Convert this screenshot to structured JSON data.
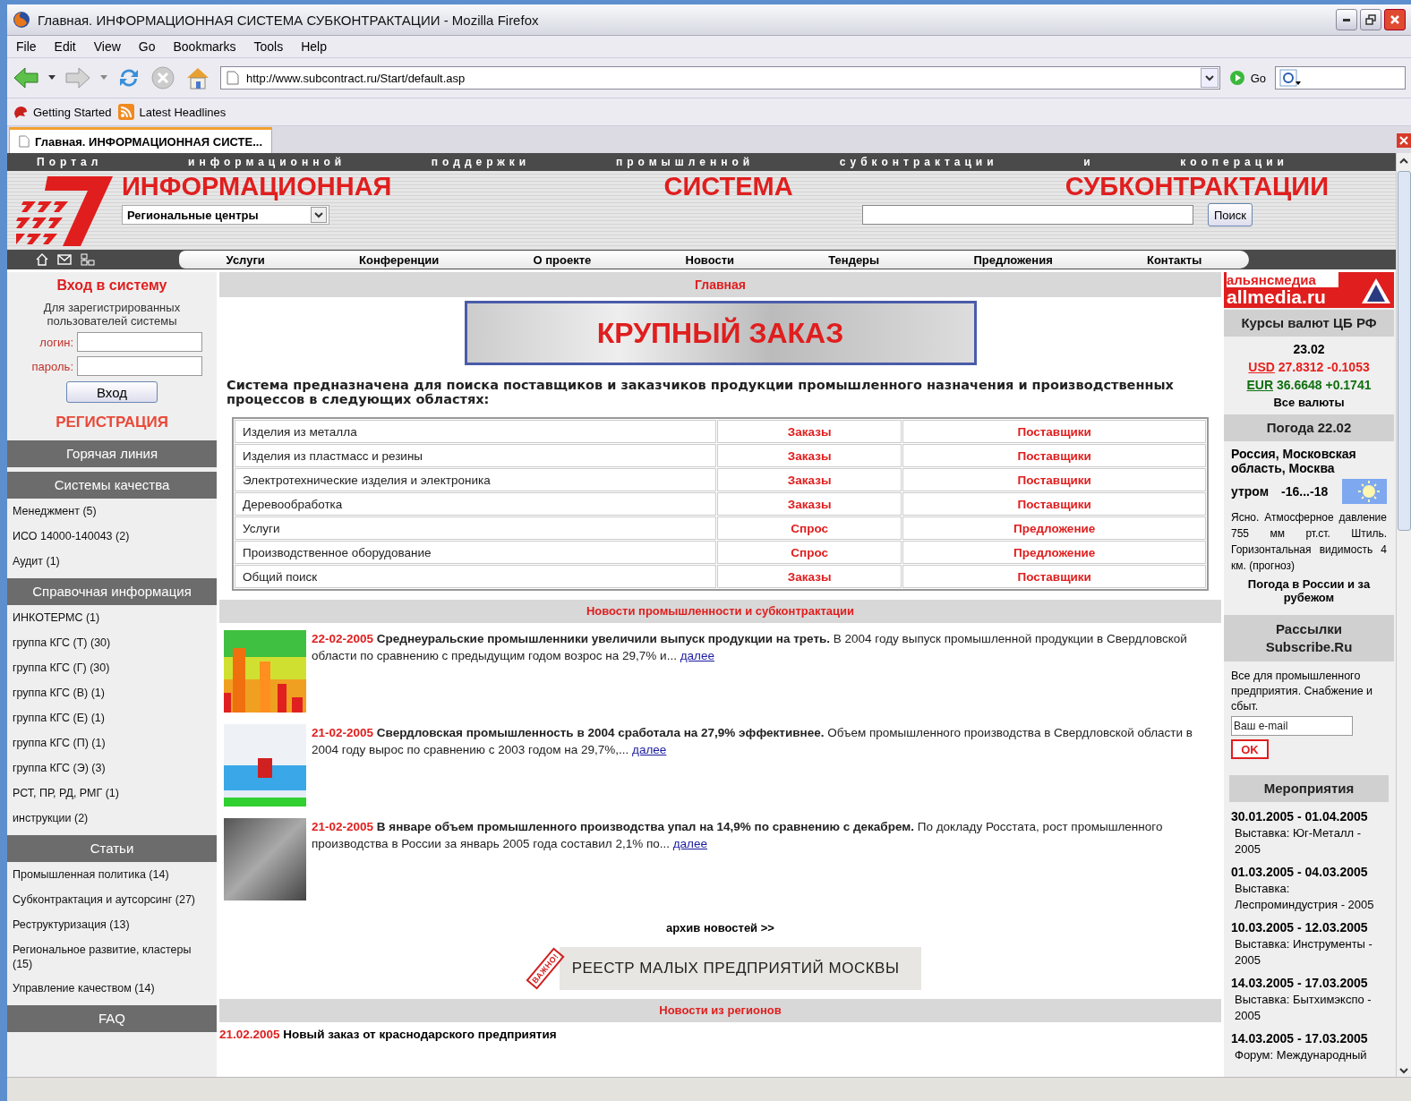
{
  "window": {
    "title": "Главная. ИНФОРМАЦИОННАЯ СИСТЕМА СУБКОНТРАКТАЦИИ - Mozilla Firefox"
  },
  "menu": [
    "File",
    "Edit",
    "View",
    "Go",
    "Bookmarks",
    "Tools",
    "Help"
  ],
  "address": {
    "url": "http://www.subcontract.ru/Start/default.asp",
    "go": "Go"
  },
  "bookmarks": [
    "Getting Started",
    "Latest Headlines"
  ],
  "tabs": [
    {
      "label": "Главная. ИНФОРМАЦИОННАЯ СИСТЕ...",
      "selected": true
    }
  ],
  "site": {
    "tagline": [
      "Портал",
      "информационной",
      "поддержки",
      "промышленной",
      "субконтрактации",
      "и",
      "кооперации"
    ],
    "titles": [
      "ИНФОРМАЦИОННАЯ",
      "СИСТЕМА",
      "СУБКОНТРАКТАЦИИ"
    ],
    "region_select": "Региональные центры",
    "search_button": "Поиск",
    "nav": [
      "Услуги",
      "Конференции",
      "О проекте",
      "Новости",
      "Тендеры",
      "Предложения",
      "Контакты"
    ]
  },
  "login": {
    "title": "Вход в систему",
    "note": "Для зарегистрированных пользователей системы",
    "login_label": "логин:",
    "password_label": "пароль:",
    "button": "Вход",
    "register": "РЕГИСТРАЦИЯ"
  },
  "sidebar": [
    {
      "title": "Горячая линия"
    },
    {
      "title": "Системы качества",
      "items": [
        "Менеджмент (5)",
        "ИСО 14000-140043 (2)",
        "Аудит (1)"
      ]
    },
    {
      "title": "Справочная информация",
      "items": [
        "ИНКОТЕРМС (1)",
        "группа КГС (Т) (30)",
        "группа КГС (Г) (30)",
        "группа КГС (В) (1)",
        "группа КГС (Е) (1)",
        "группа КГС (П) (1)",
        "группа КГС (Э) (3)",
        "РСТ, ПР, РД, РМГ (1)",
        "инструкции (2)"
      ]
    },
    {
      "title": "Статьи",
      "items": [
        "Промышленная политика (14)",
        "Субконтрактация и аутсорсинг (27)",
        "Реструктуризация (13)",
        "Региональное развитие, кластеры (15)",
        "Управление качеством (14)"
      ]
    },
    {
      "title": "FAQ"
    }
  ],
  "main": {
    "heading": "Главная",
    "banner": "КРУПНЫЙ ЗАКАЗ",
    "intro": "Система предназначена для поиска поставщиков и заказчиков продукции промышленного назначения и производственных процессов в следующих областях:",
    "areas": [
      {
        "name": "Изделия из металла",
        "col_2": "Заказы",
        "col_3": "Поставщики"
      },
      {
        "name": "Изделия из пластмасс и резины",
        "col_2": "Заказы",
        "col_3": "Поставщики"
      },
      {
        "name": "Электротехнические изделия и электроника",
        "col_2": "Заказы",
        "col_3": "Поставщики"
      },
      {
        "name": "Деревообработка",
        "col_2": "Заказы",
        "col_3": "Поставщики"
      },
      {
        "name": "Услуги",
        "col_2": "Спрос",
        "col_3": "Предложение"
      },
      {
        "name": "Производственное оборудование",
        "col_2": "Спрос",
        "col_3": "Предложение"
      },
      {
        "name": "Общий поиск",
        "col_2": "Заказы",
        "col_3": "Поставщики"
      }
    ],
    "news_heading": "Новости промышленности и субконтрактации",
    "news": [
      {
        "date": "22-02-2005",
        "title": "Среднеуральские промышленники увеличили выпуск продукции на треть.",
        "text": "В 2004 году выпуск промышленной продукции в Свердловской области по сравнению с предыдущим годом возрос на 29,7% и...",
        "more": "далее"
      },
      {
        "date": "21-02-2005",
        "title": "Свердловская промышленность в 2004 сработала на 27,9% эффективнее.",
        "text": "Объем промышленного производства в Свердловской области в 2004 году вырос по сравнению с 2003 годом на 29,7%,...",
        "more": "далее"
      },
      {
        "date": "21-02-2005",
        "title": "В январе объем промышленного производства упал на 14,9% по сравнению с декабрем.",
        "text": "По докладу Росстата, рост промышленного производства в России за январь 2005 года составил 2,1% по...",
        "more": "далее"
      }
    ],
    "archive": "архив новостей >>",
    "registry": {
      "stamp": "ВАЖНО!",
      "text": "РЕЕСТР МАЛЫХ ПРЕДПРИЯТИЙ МОСКВЫ"
    },
    "regions_heading": "Новости из регионов",
    "regions_news": [
      {
        "date": "21.02.2005",
        "title": "Новый заказ от краснодарского предприятия"
      }
    ]
  },
  "right": {
    "logo": [
      "альянсмедиа",
      "allmedia.ru"
    ],
    "currency": {
      "title": "Курсы валют ЦБ РФ",
      "date": "23.02",
      "rates": [
        {
          "code": "USD",
          "value": "27.8312",
          "change": "-0.1053",
          "color": "#e8201c"
        },
        {
          "code": "EUR",
          "value": "36.6648",
          "change": "+0.1741",
          "color": "#107010"
        }
      ],
      "all": "Все валюты"
    },
    "weather": {
      "title": "Погода 22.02",
      "place": "Россия, Московская область, Москва",
      "time": "утром",
      "temp": "-16...-18",
      "desc": "Ясно. Атмосферное давление 755 мм рт.ст. Штиль. Горизонтальная видимость 4 км. (прогноз)",
      "link": "Погода в России и за рубежом"
    },
    "subscribe": {
      "title": "Рассылки Subscribe.Ru",
      "text": "Все для промышленного предприятия. Снабжение и сбыт.",
      "placeholder": "Ваш e-mail",
      "button": "OK"
    },
    "events": {
      "title": "Мероприятия",
      "items": [
        {
          "dates": "30.01.2005 - 01.04.2005",
          "text": "Выставка: Юг-Металл - 2005"
        },
        {
          "dates": "01.03.2005 - 04.03.2005",
          "text": "Выставка: Леспроминдустрия - 2005"
        },
        {
          "dates": "10.03.2005 - 12.03.2005",
          "text": "Выставка: Инструменты - 2005"
        },
        {
          "dates": "14.03.2005 - 17.03.2005",
          "text": "Выставка: Бытхимэкспо - 2005"
        },
        {
          "dates": "14.03.2005 - 17.03.2005",
          "text": "Форум: Международный"
        }
      ]
    }
  }
}
